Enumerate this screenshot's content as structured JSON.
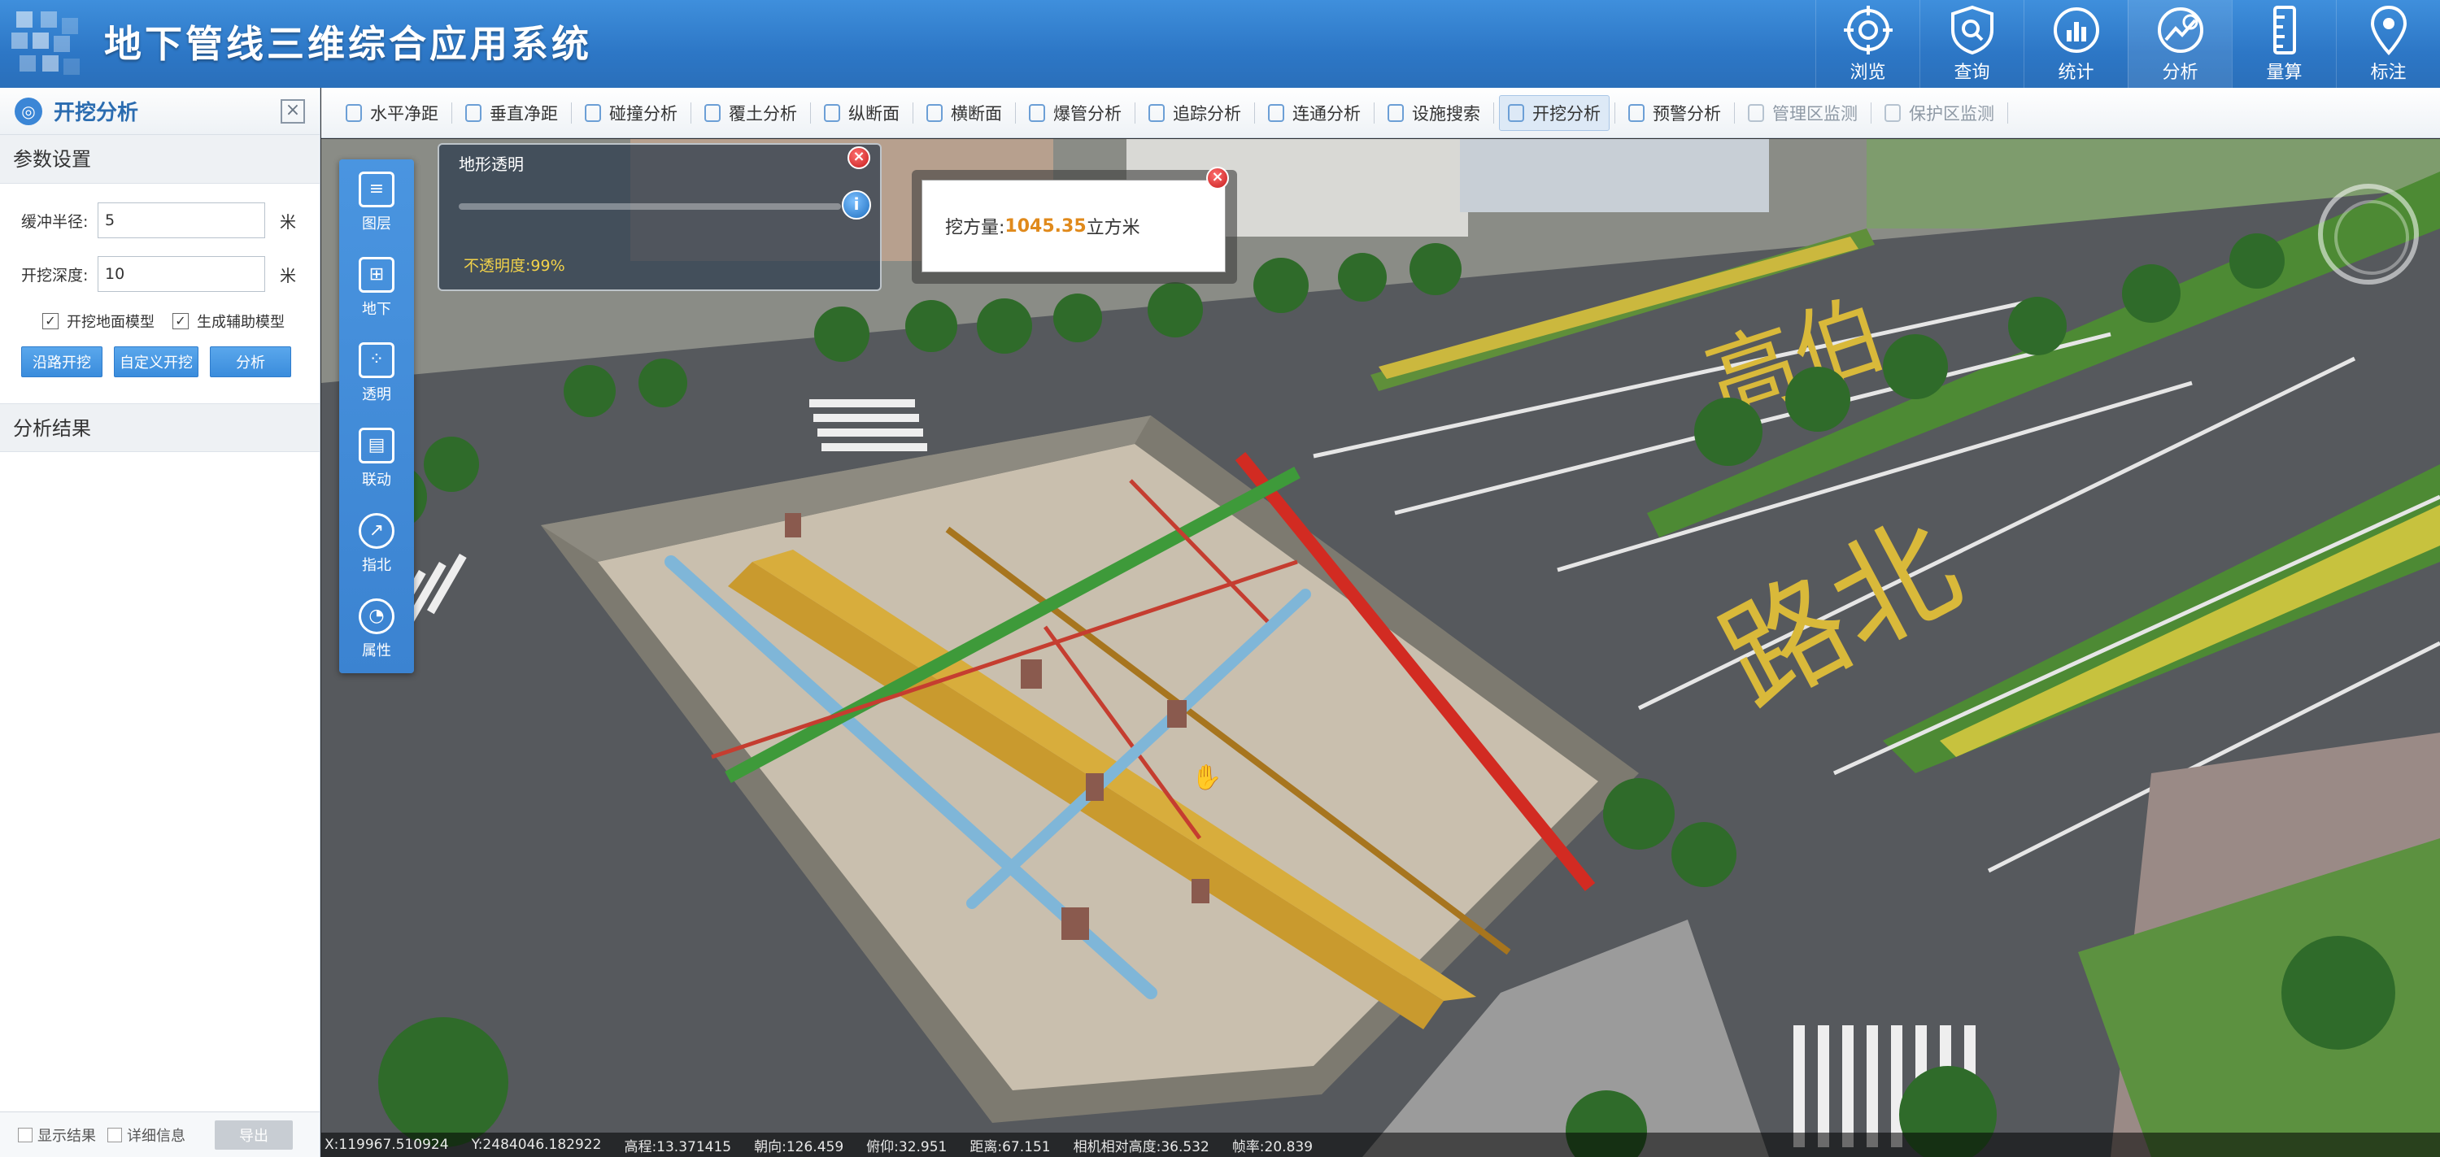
{
  "header": {
    "title": "地下管线三维综合应用系统",
    "nav": [
      {
        "label": "浏览",
        "icon": "browse-icon"
      },
      {
        "label": "查询",
        "icon": "query-icon"
      },
      {
        "label": "统计",
        "icon": "statistics-icon"
      },
      {
        "label": "分析",
        "icon": "analysis-icon",
        "active": true
      },
      {
        "label": "量算",
        "icon": "measure-icon"
      },
      {
        "label": "标注",
        "icon": "annotate-icon"
      }
    ]
  },
  "left_panel": {
    "title": "开挖分析",
    "params_title": "参数设置",
    "buffer_label": "缓冲半径:",
    "buffer_value": "5",
    "buffer_unit": "米",
    "depth_label": "开挖深度:",
    "depth_value": "10",
    "depth_unit": "米",
    "chk_ground": "开挖地面模型",
    "chk_ground_checked": true,
    "chk_aux": "生成辅助模型",
    "chk_aux_checked": true,
    "btn_road": "沿路开挖",
    "btn_custom": "自定义开挖",
    "btn_analyze": "分析",
    "result_title": "分析结果",
    "footer": {
      "show_result": "显示结果",
      "detail_info": "详细信息",
      "export": "导出"
    }
  },
  "toolbar": {
    "items": [
      {
        "label": "水平净距"
      },
      {
        "label": "垂直净距"
      },
      {
        "label": "碰撞分析"
      },
      {
        "label": "覆土分析"
      },
      {
        "label": "纵断面"
      },
      {
        "label": "横断面"
      },
      {
        "label": "爆管分析"
      },
      {
        "label": "追踪分析"
      },
      {
        "label": "连通分析"
      },
      {
        "label": "设施搜索"
      },
      {
        "label": "开挖分析",
        "active": true
      },
      {
        "label": "预警分析"
      },
      {
        "label": "管理区监测",
        "dim": true
      },
      {
        "label": "保护区监测",
        "dim": true
      }
    ]
  },
  "side_tools": [
    {
      "label": "图层",
      "icon": "layers-icon"
    },
    {
      "label": "地下",
      "icon": "underground-icon"
    },
    {
      "label": "透明",
      "icon": "transparent-icon"
    },
    {
      "label": "联动",
      "icon": "linkage-icon"
    },
    {
      "label": "指北",
      "icon": "north-icon"
    },
    {
      "label": "属性",
      "icon": "property-icon"
    }
  ],
  "opacity_popup": {
    "title": "地形透明",
    "value_text": "不透明度:99%",
    "value": 0.99
  },
  "volume_popup": {
    "prefix": "挖方量:",
    "value": "1045.35",
    "unit": "立方米"
  },
  "status": {
    "x": "X:119967.510924",
    "y": "Y:2484046.182922",
    "elev": "高程:13.371415",
    "heading": "朝向:126.459",
    "tilt": "俯仰:32.951",
    "distance": "距离:67.151",
    "cam_height": "相机相对高度:36.532",
    "rate": "帧率:20.839"
  },
  "road_text": "路北高伯"
}
